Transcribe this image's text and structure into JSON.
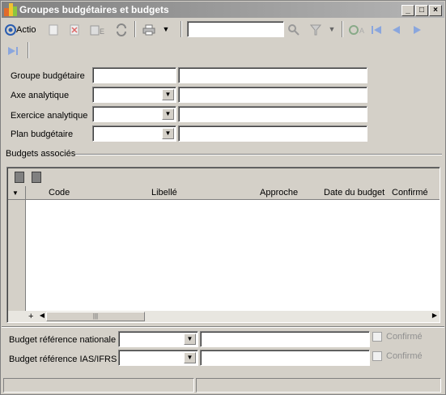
{
  "window": {
    "title": "Groupes budgétaires et budgets"
  },
  "titlebar_buttons": {
    "minimize": "_",
    "maximize": "□",
    "close": "×"
  },
  "toolbar": {
    "action_label": "Actio",
    "search_value": "",
    "icons": [
      "action-icon",
      "new-icon",
      "delete-icon",
      "export-icon",
      "refresh-icon",
      "print-icon",
      "search-icon",
      "filter-icon",
      "goto-icon",
      "first-icon",
      "previous-icon",
      "next-icon",
      "last-icon"
    ]
  },
  "form": {
    "groupe_budgetaire": {
      "label": "Groupe budgétaire",
      "code": "",
      "description": ""
    },
    "axe_analytique": {
      "label": "Axe analytique",
      "code": "",
      "description": ""
    },
    "exercice_analytique": {
      "label": "Exercice analytique",
      "code": "",
      "description": ""
    },
    "plan_budgetaire": {
      "label": "Plan budgétaire",
      "code": "",
      "description": ""
    }
  },
  "budgets": {
    "section_label": "Budgets associés",
    "columns": [
      "Code",
      "Libellé",
      "Approche",
      "Date du budget",
      "Confirmé"
    ],
    "rows": [],
    "add_symbol": "+"
  },
  "references": {
    "nationale": {
      "label": "Budget référence nationale",
      "code": "",
      "description": "",
      "confirm_label": "Confirmé",
      "confirmed": false
    },
    "ifrs": {
      "label": "Budget référence IAS/IFRS",
      "code": "",
      "description": "",
      "confirm_label": "Confirmé",
      "confirmed": false
    }
  },
  "colors": {
    "background": "#d4d0c8",
    "titlebar_start": "#808080",
    "titlebar_end": "#b5b5b5",
    "nav_icon": "#6b8ed6"
  }
}
